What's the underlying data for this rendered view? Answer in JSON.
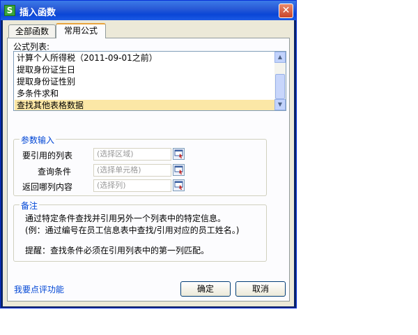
{
  "window": {
    "title": "插入函数",
    "app_icon_letter": "S"
  },
  "tabs": [
    {
      "label": "全部函数",
      "active": false
    },
    {
      "label": "常用公式",
      "active": true
    }
  ],
  "formula_list": {
    "label": "公式列表:",
    "items": [
      "计算个人所得税（2011-09-01之前）",
      "提取身份证生日",
      "提取身份证性别",
      "多条件求和",
      "查找其他表格数据"
    ],
    "selected_index": 4
  },
  "params": {
    "title": "参数输入",
    "fields": [
      {
        "label": "要引用的列表",
        "placeholder": "(选择区域)"
      },
      {
        "label": "查询条件",
        "placeholder": "(选择单元格)"
      },
      {
        "label": "返回哪列内容",
        "placeholder": "(选择列)"
      }
    ]
  },
  "notes": {
    "title": "备注",
    "lines": [
      "通过特定条件查找并引用另外一个列表中的特定信息。",
      "(例：通过编号在员工信息表中查找/引用对应的员工姓名。)",
      "提醒：查找条件必须在引用列表中的第一列匹配。"
    ]
  },
  "footer": {
    "feedback_link": "我要点评功能",
    "ok_label": "确定",
    "cancel_label": "取消"
  },
  "colors": {
    "title_bar": "#2a5bd7",
    "selection": "#fbe7a6",
    "group_title": "#0046d5"
  }
}
